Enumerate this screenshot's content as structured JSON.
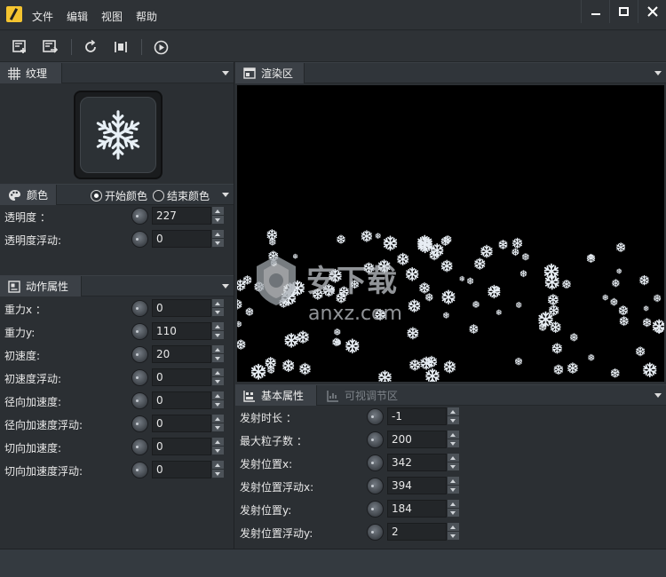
{
  "menu": [
    "文件",
    "编辑",
    "视图",
    "帮助"
  ],
  "toolbar": {
    "buttons": [
      "new-emitter-icon",
      "export-icon",
      "reset-icon",
      "fit-icon",
      "play-icon"
    ]
  },
  "texture_panel": {
    "title": "纹理",
    "icon": "texture-grid-icon"
  },
  "color_panel": {
    "title": "颜色",
    "radio_start": "开始颜色",
    "radio_end": "结束颜色",
    "selected": "开始颜色",
    "rows": [
      {
        "label": "透明度 ：",
        "value": "227"
      },
      {
        "label": "透明度浮动:",
        "value": "0"
      }
    ]
  },
  "motion_panel": {
    "title": "动作属性",
    "rows": [
      {
        "label": "重力x ：",
        "value": "0"
      },
      {
        "label": "重力y:",
        "value": "110"
      },
      {
        "label": "初速度:",
        "value": "20"
      },
      {
        "label": "初速度浮动:",
        "value": "0"
      },
      {
        "label": "径向加速度:",
        "value": "0"
      },
      {
        "label": "径向加速度浮动:",
        "value": "0"
      },
      {
        "label": "切向加速度:",
        "value": "0"
      },
      {
        "label": "切向加速度浮动:",
        "value": "0"
      }
    ]
  },
  "render_panel": {
    "title": "渲染区"
  },
  "watermark": {
    "line1": "安下载",
    "line2": "anxz.com"
  },
  "basic_panel": {
    "tab_active": "基本属性",
    "tab_inactive": "可视调节区",
    "rows": [
      {
        "label": "发射时长 ：",
        "value": "-1"
      },
      {
        "label": "最大粒子数 ：",
        "value": "200"
      },
      {
        "label": "发射位置x:",
        "value": "342"
      },
      {
        "label": "发射位置浮动x:",
        "value": "394"
      },
      {
        "label": "发射位置y:",
        "value": "184"
      },
      {
        "label": "发射位置浮动y:",
        "value": "2"
      }
    ]
  },
  "colors": {
    "accent": "#f4c430",
    "background": "#2b2f33",
    "render_bg": "#000000"
  }
}
